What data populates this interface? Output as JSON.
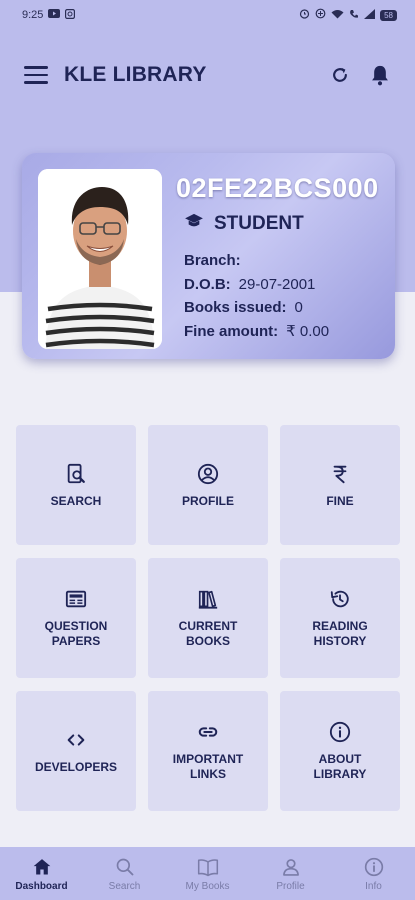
{
  "status_bar": {
    "time": "9:25",
    "left_icons": [
      "youtube-icon",
      "gallery-icon"
    ],
    "right_icons": [
      "alarm-icon",
      "data-saver-icon",
      "wifi-icon",
      "call-icon",
      "signal-icon"
    ],
    "battery": "58"
  },
  "app_bar": {
    "title": "KLE LIBRARY",
    "icons": [
      "menu-icon",
      "refresh-icon",
      "bell-icon"
    ]
  },
  "id_card": {
    "student_id": "02FE22BCS000",
    "role": "STUDENT",
    "role_icon": "graduation-cap-icon",
    "fields": [
      {
        "label": "Branch:",
        "value": ""
      },
      {
        "label": "D.O.B:",
        "value": "29-07-2001"
      },
      {
        "label": "Books issued:",
        "value": "0"
      },
      {
        "label": "Fine amount:",
        "value": "₹ 0.00"
      }
    ]
  },
  "tiles": [
    {
      "label": "SEARCH",
      "icon": "search-book-icon"
    },
    {
      "label": "PROFILE",
      "icon": "user-circle-icon"
    },
    {
      "label": "FINE",
      "icon": "rupee-icon"
    },
    {
      "label": "QUESTION PAPERS",
      "icon": "newspaper-icon"
    },
    {
      "label": "CURRENT BOOKS",
      "icon": "books-icon"
    },
    {
      "label": "READING HISTORY",
      "icon": "history-icon"
    },
    {
      "label": "DEVELOPERS",
      "icon": "code-icon"
    },
    {
      "label": "IMPORTANT LINKS",
      "icon": "link-icon"
    },
    {
      "label": "ABOUT LIBRARY",
      "icon": "info-icon"
    }
  ],
  "bottom_nav": [
    {
      "label": "Dashboard",
      "icon": "home-icon",
      "active": true
    },
    {
      "label": "Search",
      "icon": "search-icon",
      "active": false
    },
    {
      "label": "My Books",
      "icon": "open-book-icon",
      "active": false
    },
    {
      "label": "Profile",
      "icon": "person-icon",
      "active": false
    },
    {
      "label": "Info",
      "icon": "info-icon",
      "active": false
    }
  ],
  "colors": {
    "primary_dark": "#1f2456",
    "hero_background": "#bbbcec",
    "tile_background": "#dcdcf2",
    "page_background": "#eeeef6"
  }
}
